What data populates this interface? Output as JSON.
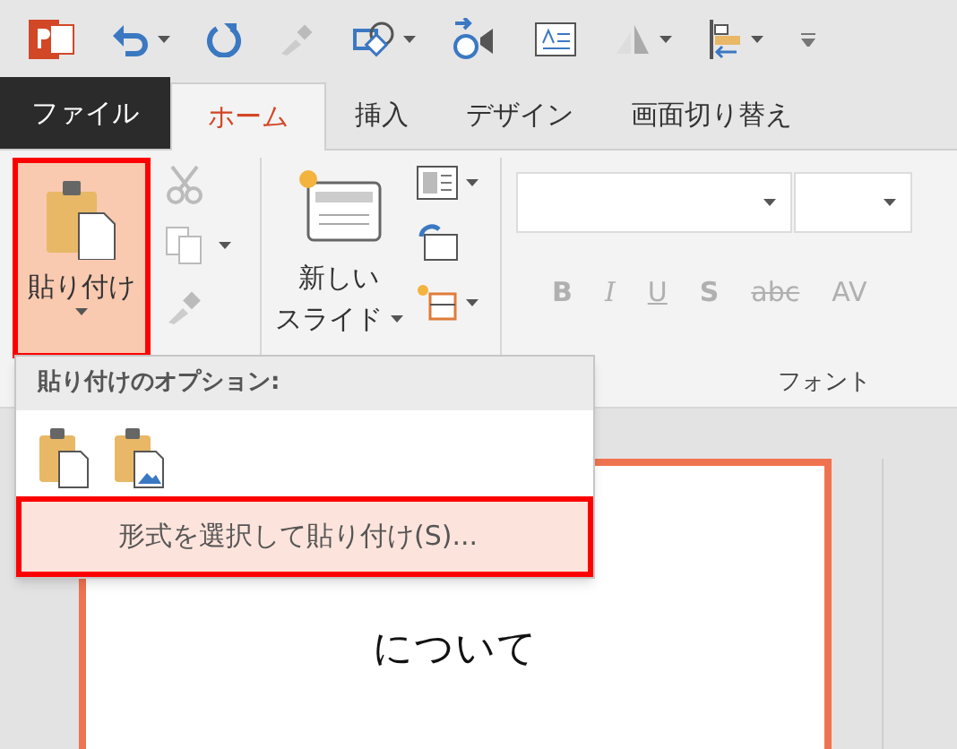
{
  "tabs": [
    {
      "label": "ファイル",
      "kind": "file",
      "selected": false
    },
    {
      "label": "ホーム",
      "kind": "tab",
      "selected": true
    },
    {
      "label": "挿入",
      "kind": "tab",
      "selected": false
    },
    {
      "label": "デザイン",
      "kind": "tab",
      "selected": false
    },
    {
      "label": "画面切り替え",
      "kind": "tab",
      "selected": false
    }
  ],
  "ribbon": {
    "paste": {
      "label": "貼り付け",
      "highlighted": true
    },
    "new_slide": {
      "line_1": "新しい",
      "line_2": "スライド"
    },
    "font_group": {
      "label": "フォント",
      "buttons": [
        {
          "label": "B",
          "disabled": true
        },
        {
          "label": "I",
          "disabled": true
        },
        {
          "label": "U",
          "disabled": true
        },
        {
          "label": "S",
          "disabled": true
        },
        {
          "label": "abc",
          "disabled": true
        },
        {
          "label": "AV",
          "disabled": true
        }
      ]
    }
  },
  "paste_menu": {
    "header": "貼り付けのオプション:",
    "special_item": {
      "label": "形式を選択して貼り付け(S)...",
      "highlighted": true
    }
  },
  "slide": {
    "title": "について"
  }
}
